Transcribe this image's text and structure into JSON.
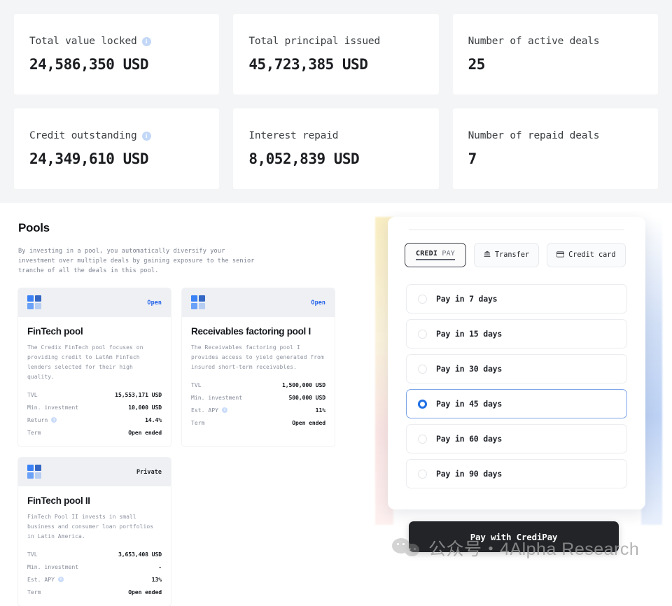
{
  "stats": [
    {
      "label": "Total value locked",
      "value": "24,586,350 USD",
      "info": true
    },
    {
      "label": "Total principal issued",
      "value": "45,723,385 USD",
      "info": false
    },
    {
      "label": "Number of active deals",
      "value": "25",
      "info": false
    },
    {
      "label": "Credit outstanding",
      "value": "24,349,610 USD",
      "info": true
    },
    {
      "label": "Interest repaid",
      "value": "8,052,839 USD",
      "info": false
    },
    {
      "label": "Number of repaid deals",
      "value": "7",
      "info": false
    }
  ],
  "pools": {
    "title": "Pools",
    "description": "By investing in a pool, you automatically diversify your investment over multiple deals by gaining exposure to the senior tranche of all the deals in this pool.",
    "cards": [
      {
        "badge": "Open",
        "badge_type": "open",
        "name": "FinTech pool",
        "description": "The Credix FinTech pool focuses on providing credit to LatAm FinTech lenders selected for their high quality.",
        "rows": [
          {
            "key": "TVL",
            "value": "15,553,171 USD",
            "info": false
          },
          {
            "key": "Min. investment",
            "value": "10,000 USD",
            "info": false
          },
          {
            "key": "Return",
            "value": "14.4%",
            "info": true
          },
          {
            "key": "Term",
            "value": "Open ended",
            "info": false
          }
        ]
      },
      {
        "badge": "Open",
        "badge_type": "open",
        "name": "Receivables factoring pool I",
        "description": "The Receivables factoring pool I provides access to yield generated from insured short-term receivables.",
        "rows": [
          {
            "key": "TVL",
            "value": "1,500,000 USD",
            "info": false
          },
          {
            "key": "Min. investment",
            "value": "500,000 USD",
            "info": false
          },
          {
            "key": "Est. APY",
            "value": "11%",
            "info": true
          },
          {
            "key": "Term",
            "value": "Open ended",
            "info": false
          }
        ]
      },
      {
        "badge": "Private",
        "badge_type": "private",
        "name": "FinTech pool II",
        "description": "FinTech Pool II invests in small business and consumer loan portfolios in Latin America.",
        "rows": [
          {
            "key": "TVL",
            "value": "3,653,408 USD",
            "info": false
          },
          {
            "key": "Min. investment",
            "value": "-",
            "info": false
          },
          {
            "key": "Est. APY",
            "value": "13%",
            "info": true
          },
          {
            "key": "Term",
            "value": "Open ended",
            "info": false
          }
        ]
      }
    ]
  },
  "pay": {
    "tabs": [
      {
        "id": "credipay",
        "brand_bold": "CREDI",
        "brand_light": "PAY",
        "active": true
      },
      {
        "id": "transfer",
        "label": "Transfer",
        "icon": "bank-icon",
        "glyph": "Ἶ6",
        "active": false
      },
      {
        "id": "credit-card",
        "label": "Credit card",
        "icon": "credit-card-icon",
        "glyph": "▤",
        "active": false
      }
    ],
    "options": [
      {
        "label": "Pay in 7 days",
        "selected": false
      },
      {
        "label": "Pay in 15 days",
        "selected": false
      },
      {
        "label": "Pay in 30 days",
        "selected": false
      },
      {
        "label": "Pay in 45 days",
        "selected": true
      },
      {
        "label": "Pay in 60 days",
        "selected": false
      },
      {
        "label": "Pay in 90 days",
        "selected": false
      }
    ],
    "submit_label": "Pay with CrediPay"
  },
  "watermark": {
    "text": "公众号・4Alpha Research"
  },
  "colors": {
    "accent_blue": "#2563eb",
    "selected_border": "#7ba5e8",
    "panel_bg": "#f4f5f7",
    "dark_button": "#222427"
  }
}
